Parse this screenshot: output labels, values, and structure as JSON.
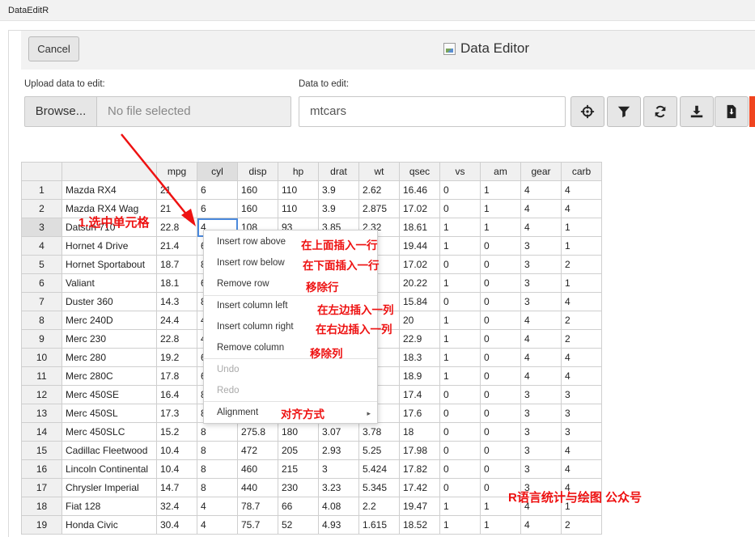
{
  "window": {
    "title": "DataEditR"
  },
  "header": {
    "cancel_label": "Cancel",
    "title": "Data Editor"
  },
  "upload": {
    "label": "Upload data to edit:",
    "browse_label": "Browse...",
    "placeholder": "No file selected"
  },
  "data_select": {
    "label": "Data to edit:",
    "value": "mtcars"
  },
  "toolbar": {
    "icons": [
      "crosshairs-icon",
      "filter-icon",
      "sync-icon",
      "download-icon",
      "file-download-icon"
    ],
    "accent_color": "#f0441f"
  },
  "table": {
    "columns": [
      "",
      "",
      "mpg",
      "cyl",
      "disp",
      "hp",
      "drat",
      "wt",
      "qsec",
      "vs",
      "am",
      "gear",
      "carb"
    ],
    "rows": [
      [
        "1",
        "Mazda RX4",
        "21",
        "6",
        "160",
        "110",
        "3.9",
        "2.62",
        "16.46",
        "0",
        "1",
        "4",
        "4"
      ],
      [
        "2",
        "Mazda RX4 Wag",
        "21",
        "6",
        "160",
        "110",
        "3.9",
        "2.875",
        "17.02",
        "0",
        "1",
        "4",
        "4"
      ],
      [
        "3",
        "Datsun 710",
        "22.8",
        "4",
        "108",
        "93",
        "3.85",
        "2.32",
        "18.61",
        "1",
        "1",
        "4",
        "1"
      ],
      [
        "4",
        "Hornet 4 Drive",
        "21.4",
        "6",
        "",
        "",
        "",
        "",
        "19.44",
        "1",
        "0",
        "3",
        "1"
      ],
      [
        "5",
        "Hornet Sportabout",
        "18.7",
        "8",
        "",
        "",
        "",
        "",
        "17.02",
        "0",
        "0",
        "3",
        "2"
      ],
      [
        "6",
        "Valiant",
        "18.1",
        "6",
        "",
        "",
        "",
        "6",
        "20.22",
        "1",
        "0",
        "3",
        "1"
      ],
      [
        "7",
        "Duster 360",
        "14.3",
        "8",
        "",
        "",
        "",
        "7",
        "15.84",
        "0",
        "0",
        "3",
        "4"
      ],
      [
        "8",
        "Merc 240D",
        "24.4",
        "4",
        "",
        "",
        "",
        "9",
        "20",
        "1",
        "0",
        "4",
        "2"
      ],
      [
        "9",
        "Merc 230",
        "22.8",
        "4",
        "",
        "",
        "",
        "5",
        "22.9",
        "1",
        "0",
        "4",
        "2"
      ],
      [
        "10",
        "Merc 280",
        "19.2",
        "6",
        "",
        "",
        "",
        "4",
        "18.3",
        "1",
        "0",
        "4",
        "4"
      ],
      [
        "11",
        "Merc 280C",
        "17.8",
        "6",
        "",
        "",
        "",
        "4",
        "18.9",
        "1",
        "0",
        "4",
        "4"
      ],
      [
        "12",
        "Merc 450SE",
        "16.4",
        "8",
        "",
        "",
        "",
        "7",
        "17.4",
        "0",
        "0",
        "3",
        "3"
      ],
      [
        "13",
        "Merc 450SL",
        "17.3",
        "8",
        "",
        "",
        "",
        "3",
        "17.6",
        "0",
        "0",
        "3",
        "3"
      ],
      [
        "14",
        "Merc 450SLC",
        "15.2",
        "8",
        "275.8",
        "180",
        "3.07",
        "3.78",
        "18",
        "0",
        "0",
        "3",
        "3"
      ],
      [
        "15",
        "Cadillac Fleetwood",
        "10.4",
        "8",
        "472",
        "205",
        "2.93",
        "5.25",
        "17.98",
        "0",
        "0",
        "3",
        "4"
      ],
      [
        "16",
        "Lincoln Continental",
        "10.4",
        "8",
        "460",
        "215",
        "3",
        "5.424",
        "17.82",
        "0",
        "0",
        "3",
        "4"
      ],
      [
        "17",
        "Chrysler Imperial",
        "14.7",
        "8",
        "440",
        "230",
        "3.23",
        "5.345",
        "17.42",
        "0",
        "0",
        "3",
        "4"
      ],
      [
        "18",
        "Fiat 128",
        "32.4",
        "4",
        "78.7",
        "66",
        "4.08",
        "2.2",
        "19.47",
        "1",
        "1",
        "4",
        "1"
      ],
      [
        "19",
        "Honda Civic",
        "30.4",
        "4",
        "75.7",
        "52",
        "4.93",
        "1.615",
        "18.52",
        "1",
        "1",
        "4",
        "2"
      ]
    ]
  },
  "context_menu": {
    "insert_row_above": "Insert row above",
    "insert_row_below": "Insert row below",
    "remove_row": "Remove row",
    "insert_column_left": "Insert column left",
    "insert_column_right": "Insert column right",
    "remove_column": "Remove column",
    "undo": "Undo",
    "redo": "Redo",
    "alignment": "Alignment",
    "submenu_arrow": "▸"
  },
  "annotations": {
    "color": "#ee1111",
    "step1": "1.选中单元格",
    "insert_row_above": "在上面插入一行",
    "insert_row_below": "在下面插入一行",
    "remove_row": "移除行",
    "insert_column_left": "在左边插入一列",
    "insert_column_right": "在右边插入一列",
    "remove_column": "移除列",
    "alignment": "对齐方式",
    "watermark": "R语言统计与绘图 公众号"
  }
}
